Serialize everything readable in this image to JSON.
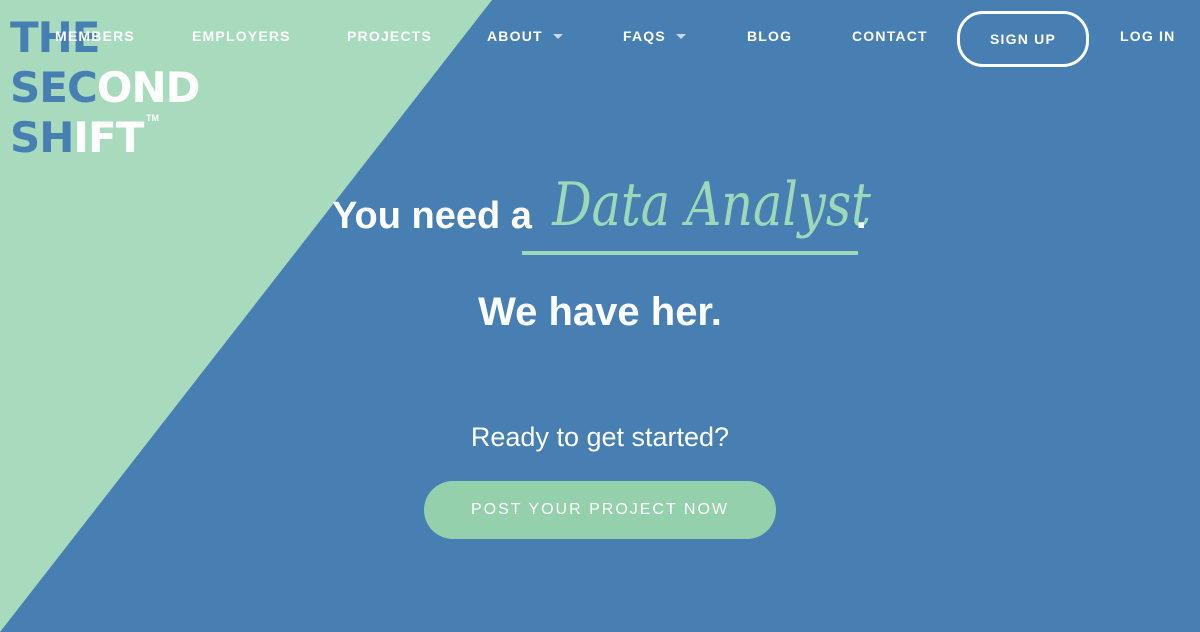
{
  "colors": {
    "background_blue": "#477fb3",
    "accent_green": "#a8dbbd",
    "role_text_green": "#9dd9b9",
    "button_green": "#94d0ac",
    "text_white": "#ffffff"
  },
  "logo": {
    "line1": "THE",
    "line2_part1": "SEC",
    "line2_part2": "OND",
    "line3_part1": "SH",
    "line3_part2": "IFT",
    "trademark": "TM"
  },
  "nav": {
    "items": [
      {
        "label": "MEMBERS"
      },
      {
        "label": "EMPLOYERS"
      },
      {
        "label": "PROJECTS"
      },
      {
        "label": "ABOUT",
        "has_dropdown": true
      },
      {
        "label": "FAQS",
        "has_dropdown": true
      },
      {
        "label": "BLOG"
      },
      {
        "label": "CONTACT"
      }
    ],
    "signup_label": "SIGN UP",
    "login_label": "LOG IN"
  },
  "hero": {
    "prefix": "You need a",
    "role": "Data Analyst",
    "suffix": ".",
    "tagline": "We have her."
  },
  "cta": {
    "prompt": "Ready to get started?",
    "button_label": "POST YOUR PROJECT NOW"
  }
}
